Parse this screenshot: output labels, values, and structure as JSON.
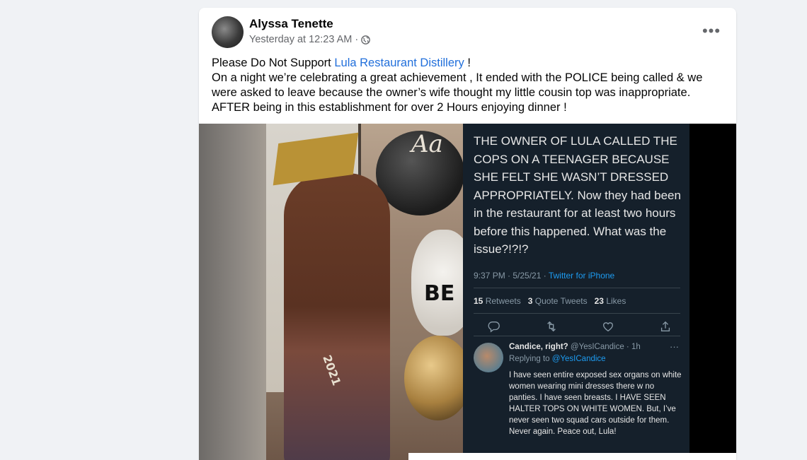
{
  "post": {
    "author": "Alyssa Tenette",
    "timestamp": "Yesterday at 12:23 AM",
    "separator": "·",
    "privacy_icon": "globe-icon",
    "more_icon": "more-horizontal-icon",
    "more_label": "•••",
    "text": {
      "line1_prefix": "Please Do Not Support ",
      "link": "Lula Restaurant Distillery",
      "line1_suffix": " !",
      "body": "On a night we’re celebrating a great achievement  , It ended with the POLICE being called & we were asked to leave because the owner’s wife thought my little cousin top was inappropriate. AFTER being in this establishment for over 2 Hours   enjoying dinner !"
    },
    "link_color": "#216fdb"
  },
  "tweet": {
    "text": "THE OWNER OF LULA CALLED THE COPS ON A TEENAGER BECAUSE SHE FELT SHE WASN’T DRESSED APPROPRIATELY. Now they had been in the restaurant for at least two hours before this happened. What was the issue?!?!?",
    "time": "9:37 PM · 5/25/21 · ",
    "source": "Twitter for iPhone",
    "retweets_count": "15",
    "retweets_label": "Retweets",
    "quotes_count": "3",
    "quotes_label": "Quote Tweets",
    "likes_count": "23",
    "likes_label": "Likes",
    "background": "#15202b",
    "reply": {
      "name": "Candice, right?",
      "handle": "@YesICandice · 1h",
      "replying_prefix": "Replying to ",
      "replying_handle": "@YesICandice",
      "text": "I have seen entire exposed sex organs on white women wearing mini dresses there w no panties. I have seen breasts. I HAVE SEEN HALTER TOPS ON WHITE WOMEN. But, I’ve never seen two squad cars outside for them. Never again. Peace out, Lula!",
      "more": "···"
    }
  },
  "photo": {
    "banner_letters": "Aa",
    "balloon_text": "BE",
    "cap_text": "2021"
  }
}
